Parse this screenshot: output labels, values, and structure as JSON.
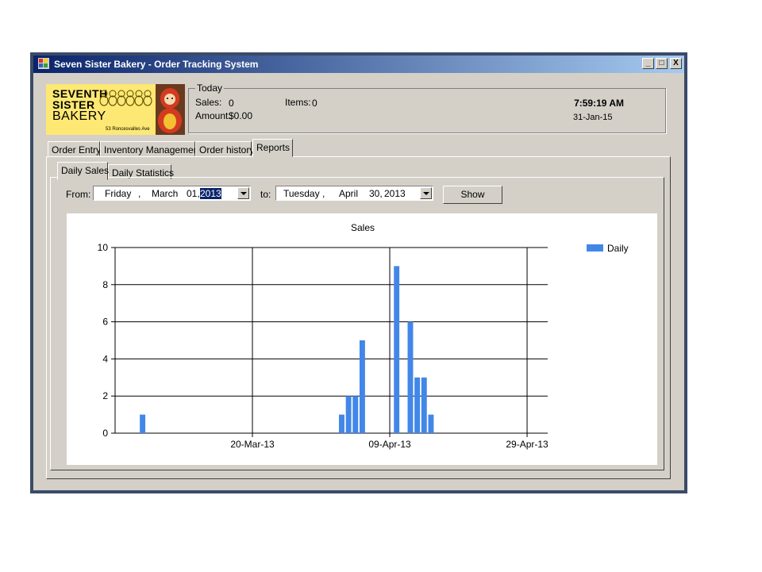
{
  "window": {
    "title": "Seven Sister Bakery - Order Tracking System",
    "controls": [
      "_",
      "□",
      "X"
    ]
  },
  "logo": {
    "line1": "SEVENTH",
    "line2": "SISTER",
    "line3": "BAKERY",
    "address": "53 Roncesvalles Ave"
  },
  "today": {
    "group_title": "Today",
    "sales_label": "Sales:",
    "sales_value": "0",
    "items_label": "Items:",
    "items_value": "0",
    "amount_label": "Amount:",
    "amount_value": "$0.00",
    "time": "7:59:19 AM",
    "date": "31-Jan-15"
  },
  "main_tabs": [
    "Order Entry",
    "Inventory Management",
    "Order history",
    "Reports"
  ],
  "main_tabs_active": "Reports",
  "report_tabs": [
    "Daily Sales",
    "Daily Statistics"
  ],
  "report_tabs_active": "Daily Sales",
  "filter": {
    "from_label": "From:",
    "from_weekday": "Friday",
    "from_comma": ",",
    "from_month": "March",
    "from_day": "01,",
    "from_year": "2013",
    "to_label": "to:",
    "to_weekday": "Tuesday",
    "to_comma": ",",
    "to_month": "April",
    "to_day": "30,",
    "to_year": "2013",
    "show_label": "Show"
  },
  "colors": {
    "bar": "#4287e8",
    "selection": "#0a246a",
    "titlebar_start": "#0a246a",
    "titlebar_end": "#a6caf0"
  },
  "chart_data": {
    "type": "bar",
    "title": "Sales",
    "xlabel": "",
    "ylabel": "",
    "ylim": [
      0,
      10
    ],
    "yticks": [
      0,
      2,
      4,
      6,
      8,
      10
    ],
    "xlim": [
      "2013-02-28",
      "2013-05-02"
    ],
    "xticks": [
      "2013-03-20",
      "2013-04-09",
      "2013-04-29"
    ],
    "xtick_labels": [
      "20-Mar-13",
      "09-Apr-13",
      "29-Apr-13"
    ],
    "grid": true,
    "legend_position": "top-right",
    "series": [
      {
        "name": "Daily",
        "color": "#4287e8",
        "points": [
          {
            "date": "2013-03-04",
            "value": 1
          },
          {
            "date": "2013-04-02",
            "value": 1
          },
          {
            "date": "2013-04-03",
            "value": 2
          },
          {
            "date": "2013-04-04",
            "value": 2
          },
          {
            "date": "2013-04-05",
            "value": 5
          },
          {
            "date": "2013-04-10",
            "value": 9
          },
          {
            "date": "2013-04-12",
            "value": 6
          },
          {
            "date": "2013-04-13",
            "value": 3
          },
          {
            "date": "2013-04-14",
            "value": 3
          },
          {
            "date": "2013-04-15",
            "value": 1
          }
        ]
      }
    ]
  }
}
